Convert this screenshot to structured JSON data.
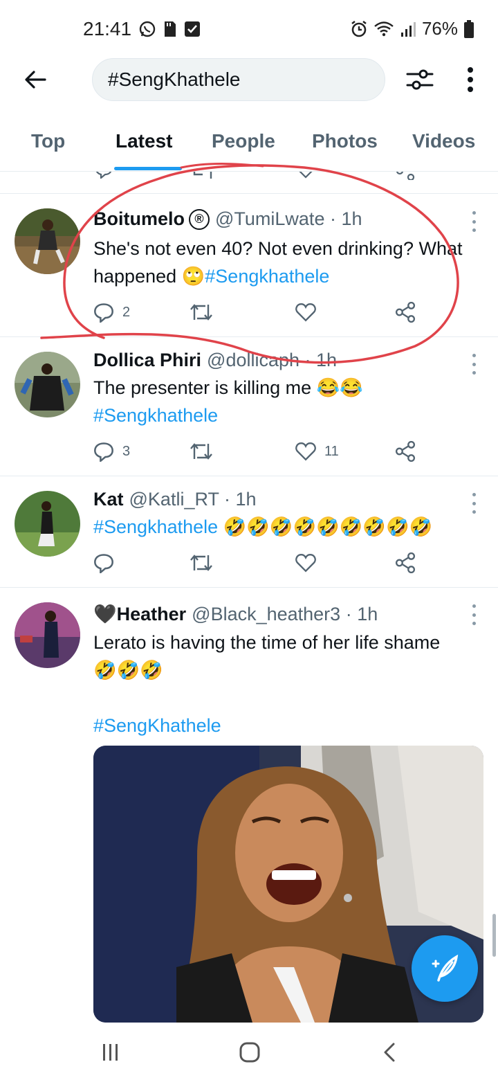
{
  "status_bar": {
    "time": "21:41",
    "battery": "76%",
    "icons": [
      "whatsapp-icon",
      "sd-card-icon",
      "checkbox-icon",
      "alarm-icon",
      "wifi-icon",
      "signal-icon",
      "battery-icon"
    ]
  },
  "header": {
    "search_value": "#SengKhathele",
    "icons": [
      "back-arrow-icon",
      "filter-icon",
      "more-vertical-icon"
    ]
  },
  "tabs": [
    {
      "label": "Top",
      "active": false
    },
    {
      "label": "Latest",
      "active": true
    },
    {
      "label": "People",
      "active": false
    },
    {
      "label": "Photos",
      "active": false
    },
    {
      "label": "Videos",
      "active": false
    }
  ],
  "tweets": [
    {
      "name": "Boitumelo",
      "badge": "®",
      "handle": "@TumiLwate · 1h",
      "text": "She's not even 40? Not even drinking? What happened",
      "emoji": "🙄",
      "hashtag": "#Sengkhathele",
      "replies": "2",
      "retweets": "",
      "likes": ""
    },
    {
      "name": "Dollica Phiri",
      "handle": "@dollicaph · 1h",
      "text": "The presenter is killing me",
      "emoji": "😂😂",
      "hashtag": "#Sengkhathele",
      "replies": "3",
      "retweets": "",
      "likes": "11"
    },
    {
      "name": "Kat",
      "handle": "@Katli_RT · 1h",
      "hashtag": "#Sengkhathele",
      "emoji": "🤣🤣🤣🤣🤣🤣🤣🤣🤣",
      "replies": "",
      "retweets": "",
      "likes": ""
    },
    {
      "name": "🖤Heather",
      "handle": "@Black_heather3 · 1h",
      "text": "Lerato is having the time of her life shame",
      "emoji": "🤣🤣🤣",
      "hashtag": "#SengKhathele"
    }
  ],
  "colors": {
    "accent": "#1d9bf0",
    "annotation": "#e0434a",
    "secondary_text": "#536471"
  },
  "fab": {
    "icon": "compose-tweet-icon"
  },
  "navbar": {
    "icons": [
      "recent-apps-icon",
      "home-icon",
      "back-icon"
    ]
  }
}
